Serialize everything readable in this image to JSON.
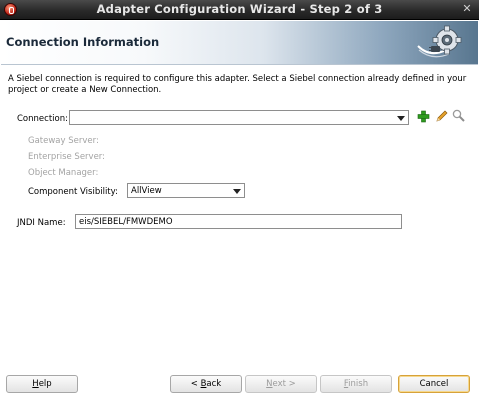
{
  "window": {
    "title": "Adapter Configuration Wizard - Step 2 of 3",
    "close_glyph": "✕"
  },
  "header": {
    "title": "Connection Information",
    "icon": "gear-plug-icon"
  },
  "intro": "A Siebel connection is required to configure this adapter. Select a Siebel connection already defined in your project or create a New Connection.",
  "connection": {
    "label": "Connection:",
    "value": ""
  },
  "gateway_server": {
    "label": "Gateway Server:"
  },
  "enterprise_server": {
    "label": "Enterprise Server:"
  },
  "object_manager": {
    "label": "Object Manager:"
  },
  "component_visibility": {
    "label": "Component Visibility:",
    "value": "AllView"
  },
  "jndi": {
    "label": "JNDI Name:",
    "value": "eis/SIEBEL/FMWDEMO"
  },
  "buttons": {
    "help": {
      "pre": "",
      "mnemonic": "H",
      "post": "elp"
    },
    "back": {
      "pre": "< ",
      "mnemonic": "B",
      "post": "ack"
    },
    "next": {
      "pre": "",
      "mnemonic": "N",
      "post": "ext >"
    },
    "finish": {
      "pre": "",
      "mnemonic": "F",
      "post": "inish"
    },
    "cancel": "Cancel"
  }
}
